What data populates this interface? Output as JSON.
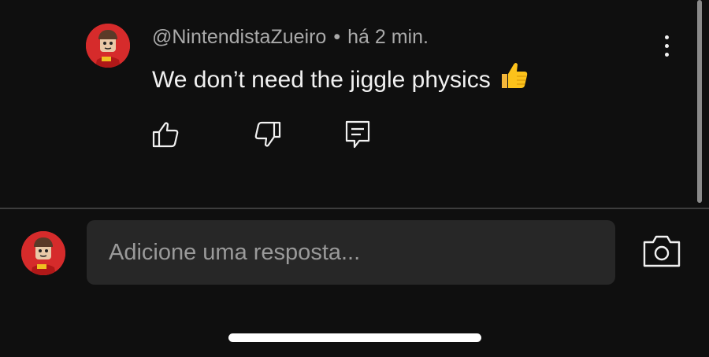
{
  "comment": {
    "author": "@NintendistaZueiro",
    "separator": "•",
    "time": "há 2 min.",
    "text": "We don’t need the jiggle physics",
    "emoji": "thumbs-up-emoji"
  },
  "actions": {
    "like_icon": "thumbs-up-icon",
    "dislike_icon": "thumbs-down-icon",
    "reply_icon": "reply-icon",
    "more_icon": "more-vertical-icon"
  },
  "compose": {
    "placeholder": "Adicione uma resposta...",
    "value": "",
    "camera_icon": "camera-icon"
  },
  "colors": {
    "background": "#0f0f0f",
    "input_background": "#272727",
    "meta_text": "#aaaaaa",
    "text": "#f1f1f1",
    "avatar": "#d62b2b"
  }
}
